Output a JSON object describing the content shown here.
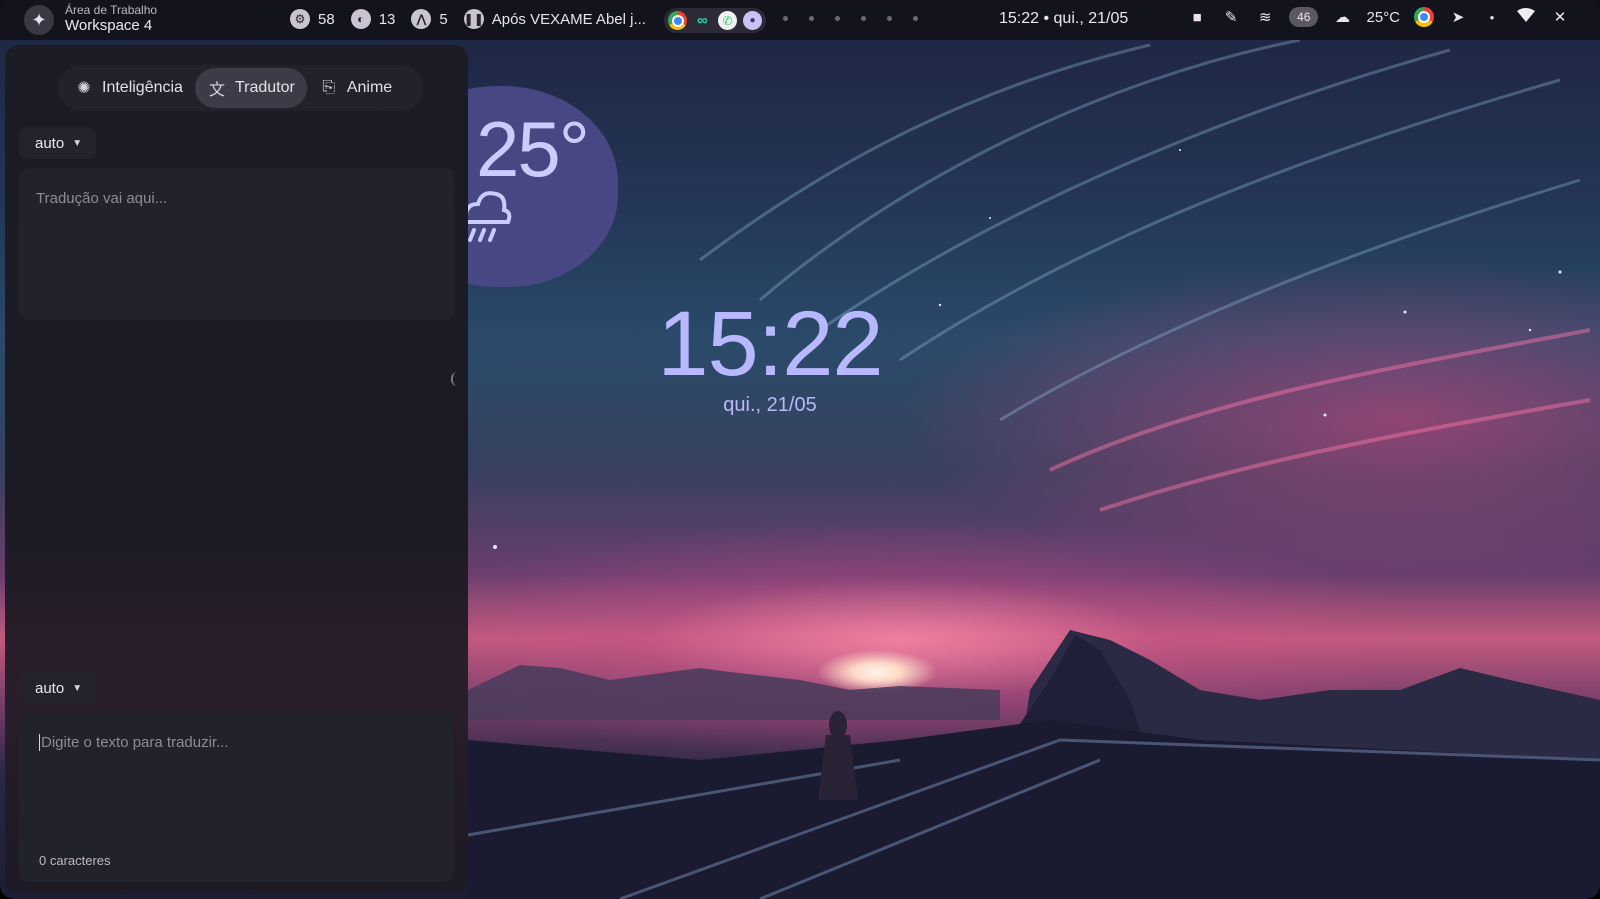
{
  "topbar": {
    "workspace_small": "Área de Trabalho",
    "workspace_name": "Workspace 4",
    "stats": [
      {
        "icon": "cpu-icon",
        "value": "58"
      },
      {
        "icon": "memory-icon",
        "value": "13"
      },
      {
        "icon": "disk-icon",
        "value": "5"
      }
    ],
    "media_title": "Após VEXAME Abel j...",
    "clock": "15:22 • qui., 21/05",
    "battery": "46",
    "weather": "25°C"
  },
  "panel": {
    "tabs": [
      {
        "icon": "brain-icon",
        "label": "Inteligência"
      },
      {
        "icon": "translate-icon",
        "label": "Tradutor"
      },
      {
        "icon": "bookmark-icon",
        "label": "Anime"
      }
    ],
    "active_tab": "Tradutor",
    "output_lang": "auto",
    "output_placeholder": "Tradução vai aqui...",
    "input_lang": "auto",
    "input_placeholder": "Digite o texto para traduzir...",
    "char_count": "0 caracteres"
  },
  "weather_widget": {
    "temp": "25°",
    "icon": "rain-cloud-icon",
    "color": "#c9ccff"
  },
  "clock_widget": {
    "time": "15:22",
    "date": "qui., 21/05",
    "color": "#b8b8ff"
  }
}
